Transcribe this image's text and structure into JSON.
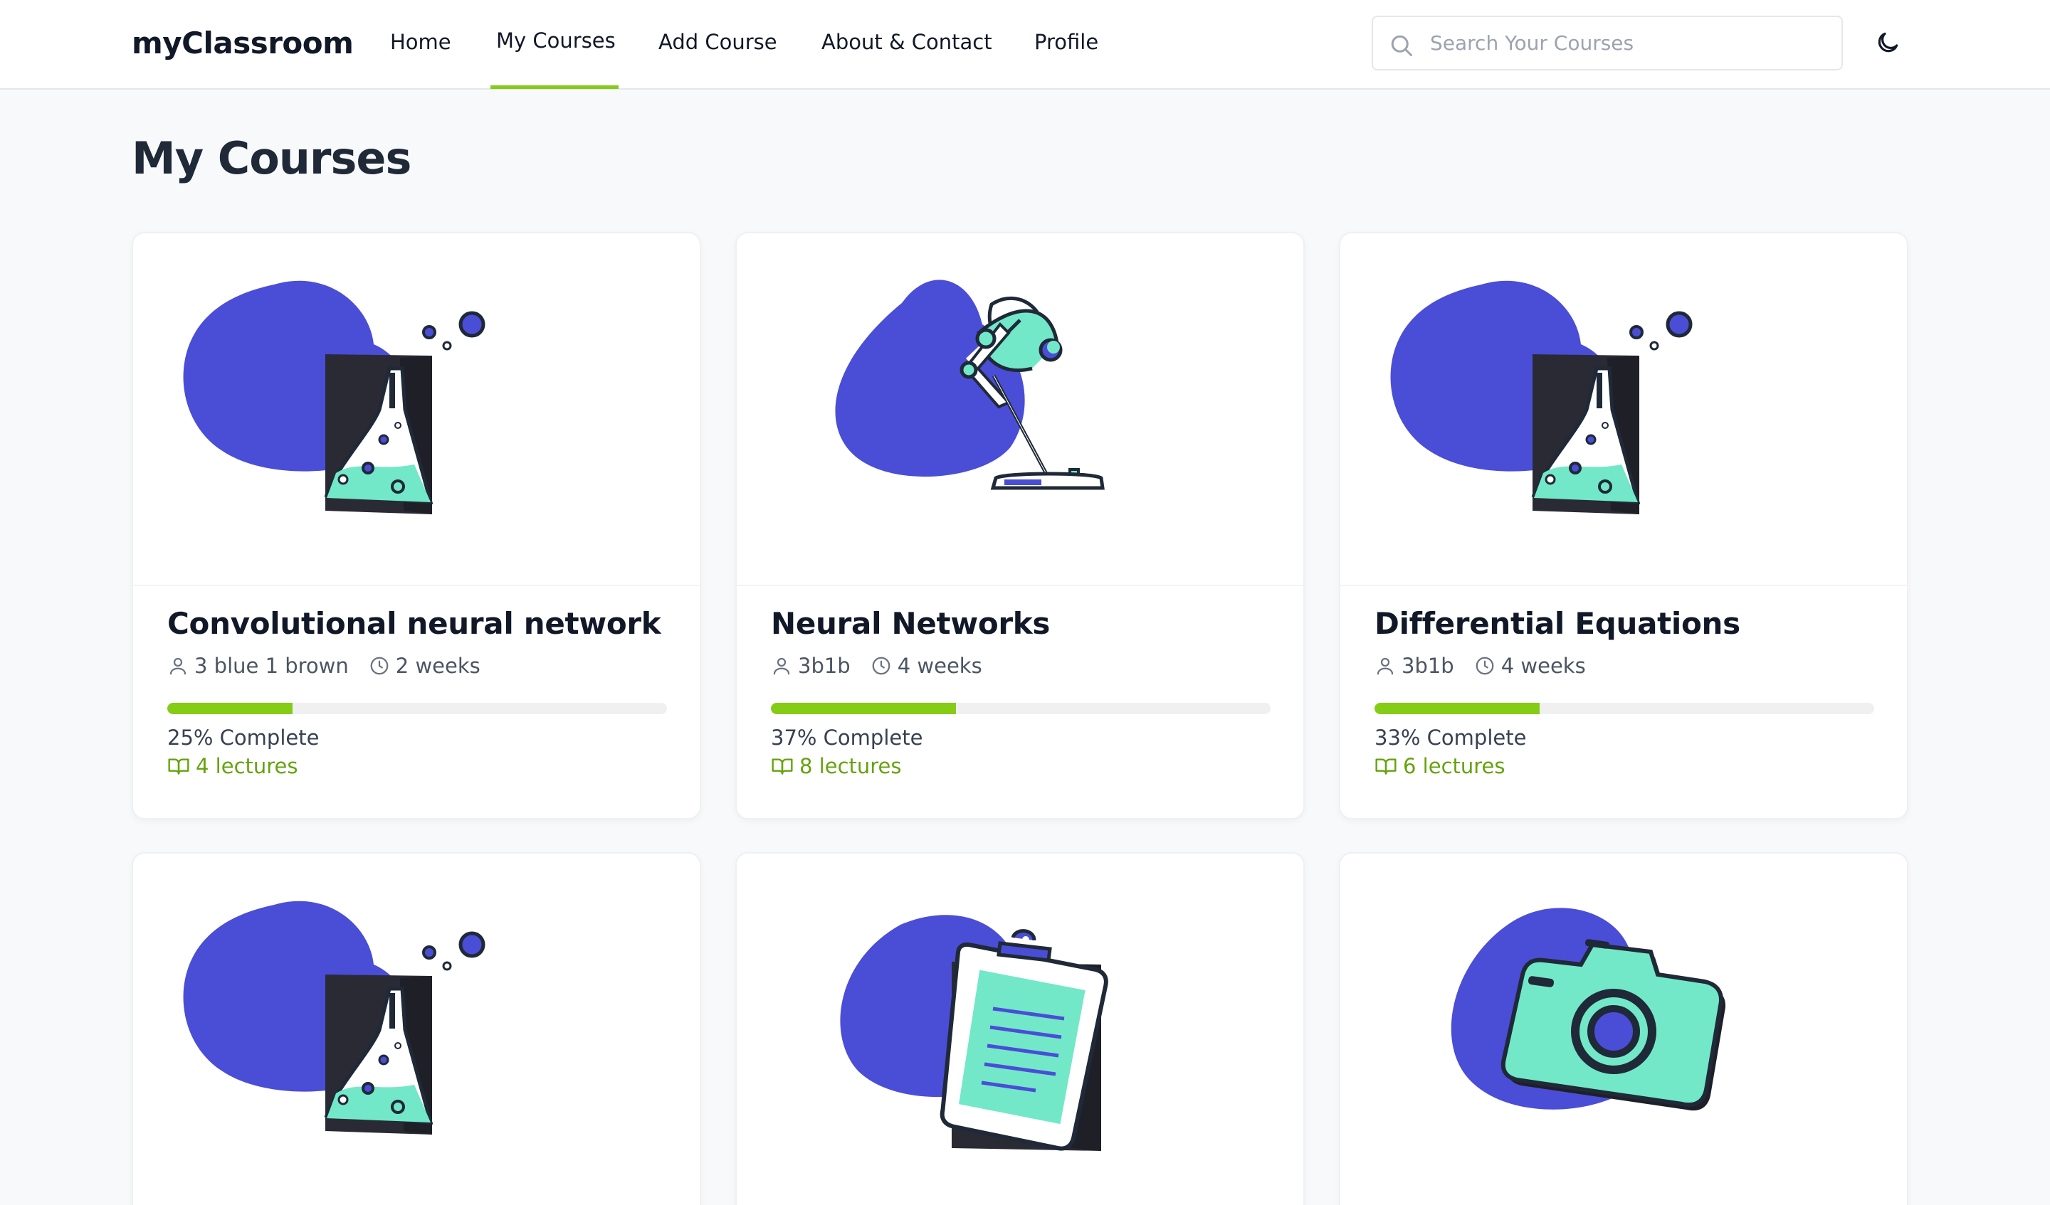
{
  "header": {
    "brand": "myClassroom",
    "nav": [
      {
        "label": "Home"
      },
      {
        "label": "My Courses"
      },
      {
        "label": "Add Course"
      },
      {
        "label": "About & Contact"
      },
      {
        "label": "Profile"
      }
    ],
    "active_nav": "My Courses",
    "search": {
      "placeholder": "Search Your Courses",
      "value": ""
    },
    "theme_icon": "moon-icon"
  },
  "page": {
    "title": "My Courses"
  },
  "courses": [
    {
      "title": "Convolutional neural network",
      "author": "3 blue 1 brown",
      "duration": "2 weeks",
      "progress": 25,
      "progress_label": "25% Complete",
      "lectures_label": "4 lectures",
      "illustration": "chemistry-flask-icon"
    },
    {
      "title": "Neural Networks",
      "author": "3b1b",
      "duration": "4 weeks",
      "progress": 37,
      "progress_label": "37% Complete",
      "lectures_label": "8 lectures",
      "illustration": "desk-lamp-icon"
    },
    {
      "title": "Differential Equations",
      "author": "3b1b",
      "duration": "4 weeks",
      "progress": 33,
      "progress_label": "33% Complete",
      "lectures_label": "6 lectures",
      "illustration": "chemistry-flask-icon"
    },
    {
      "title": "",
      "author": "",
      "duration": "",
      "progress": null,
      "progress_label": "",
      "lectures_label": "",
      "illustration": "chemistry-flask-icon"
    },
    {
      "title": "",
      "author": "",
      "duration": "",
      "progress": null,
      "progress_label": "",
      "lectures_label": "",
      "illustration": "clipboard-icon"
    },
    {
      "title": "",
      "author": "",
      "duration": "",
      "progress": null,
      "progress_label": "",
      "lectures_label": "",
      "illustration": "camera-icon"
    }
  ],
  "colors": {
    "accent": "#84cc16",
    "blob": "#4a4dd6",
    "mint": "#72e8c9",
    "dark": "#2a2a35"
  },
  "icons": {
    "author": "user-icon",
    "duration": "clock-icon",
    "lectures": "book-open-icon",
    "search": "search-icon"
  }
}
